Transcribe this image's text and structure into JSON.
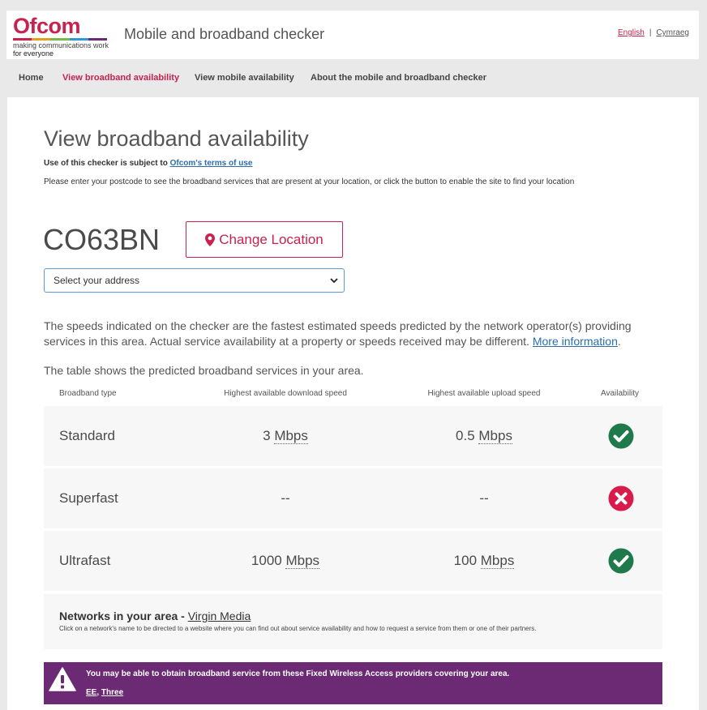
{
  "header": {
    "logo_text": "Ofcom",
    "logo_tagline_1": "making communications work",
    "logo_tagline_2": "for everyone",
    "logo_colors": [
      "#c8224e",
      "#e0a020",
      "#7ab648",
      "#2d9ad6",
      "#6b2a73"
    ],
    "title": "Mobile and broadband checker",
    "lang_english": "English",
    "lang_separator": "|",
    "lang_welsh": "Cymraeg"
  },
  "nav": {
    "items": [
      {
        "label": "Home",
        "active": false
      },
      {
        "label": "View broadband availability",
        "active": true
      },
      {
        "label": "View mobile availability",
        "active": false
      },
      {
        "label": "About the mobile and broadband checker",
        "active": false
      }
    ]
  },
  "main": {
    "title": "View broadband availability",
    "terms_prefix": "Use of this checker is subject to ",
    "terms_link": "Ofcom's terms of use",
    "instructions": "Please enter your postcode to see the broadband services that are present at your location, or click the button to enable the site to find your location",
    "postcode": "CO63BN",
    "change_location_label": "Change Location",
    "address_select_value": "Select your address",
    "speeds_note_text": "The speeds indicated on the checker are the fastest estimated speeds predicted by the network operator(s) providing services in this area. Actual service availability at a property or speeds received may be different. ",
    "speeds_note_link": "More information",
    "speeds_note_end": ".",
    "table_intro": "The table shows the predicted broadband services in your area."
  },
  "table": {
    "headers": {
      "type": "Broadband type",
      "download": "Highest available download speed",
      "upload": "Highest available upload speed",
      "availability": "Availability"
    },
    "rows": [
      {
        "type": "Standard",
        "download_value": "3",
        "download_unit": "Mbps",
        "upload_value": "0.5",
        "upload_unit": "Mbps",
        "available": true
      },
      {
        "type": "Superfast",
        "download_value": "--",
        "download_unit": "",
        "upload_value": "--",
        "upload_unit": "",
        "available": false
      },
      {
        "type": "Ultrafast",
        "download_value": "1000",
        "download_unit": "Mbps",
        "upload_value": "100",
        "upload_unit": "Mbps",
        "available": true
      }
    ],
    "available_color": "#1e7a4a",
    "unavailable_color": "#d81b4a"
  },
  "networks": {
    "title": "Networks in your area - ",
    "network_link": "Virgin Media",
    "help": "Click on a network's name to be directed to a website where you can find out about service availability and how to request a service from them or one of their partners."
  },
  "fwa": {
    "message": "You may be able to obtain broadband service from these Fixed Wireless Access providers covering your area.",
    "provider_1": "EE",
    "separator": ", ",
    "provider_2": "Three",
    "background_color": "#6b2a73"
  }
}
